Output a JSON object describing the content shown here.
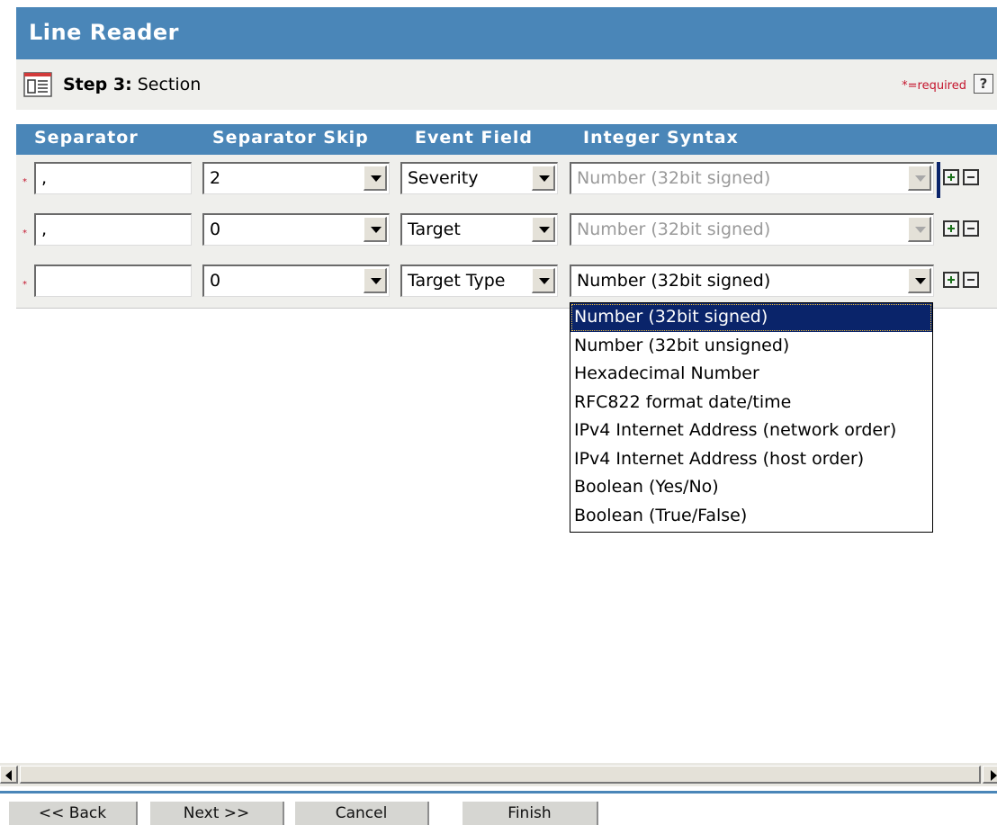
{
  "window": {
    "title": "Line Reader"
  },
  "step": {
    "number_label": "Step 3:",
    "name": "Section",
    "required_note": "*=required",
    "help_glyph": "?"
  },
  "columns": [
    "Separator",
    "Separator Skip",
    "Event Field",
    "Integer Syntax"
  ],
  "rows": [
    {
      "required": "*",
      "separator": ",",
      "skip": "2",
      "event_field": "Severity",
      "integer_syntax": "Number (32bit signed)",
      "integer_syntax_disabled": true
    },
    {
      "required": "*",
      "separator": ",",
      "skip": "0",
      "event_field": "Target",
      "integer_syntax": "Number (32bit signed)",
      "integer_syntax_disabled": true
    },
    {
      "required": "*",
      "separator": "",
      "skip": "0",
      "event_field": "Target Type",
      "integer_syntax": "Number (32bit signed)",
      "integer_syntax_disabled": false
    }
  ],
  "integer_syntax_options": [
    "Number (32bit signed)",
    "Number (32bit unsigned)",
    "Hexadecimal Number",
    "RFC822 format date/time",
    "IPv4 Internet Address (network order)",
    "IPv4 Internet Address (host order)",
    "Boolean (Yes/No)",
    "Boolean (True/False)"
  ],
  "selected_option_index": 0,
  "footer": {
    "back": "<< Back",
    "next": "Next >>",
    "cancel": "Cancel",
    "finish": "Finish"
  },
  "colors": {
    "header_blue": "#4a86b8",
    "panel_gray": "#efefec",
    "required_red": "#c4142c",
    "selection_navy": "#0a246a"
  },
  "icons": {
    "step": "section-icon",
    "help": "help-icon",
    "add": "plus-icon",
    "remove": "minus-icon"
  }
}
